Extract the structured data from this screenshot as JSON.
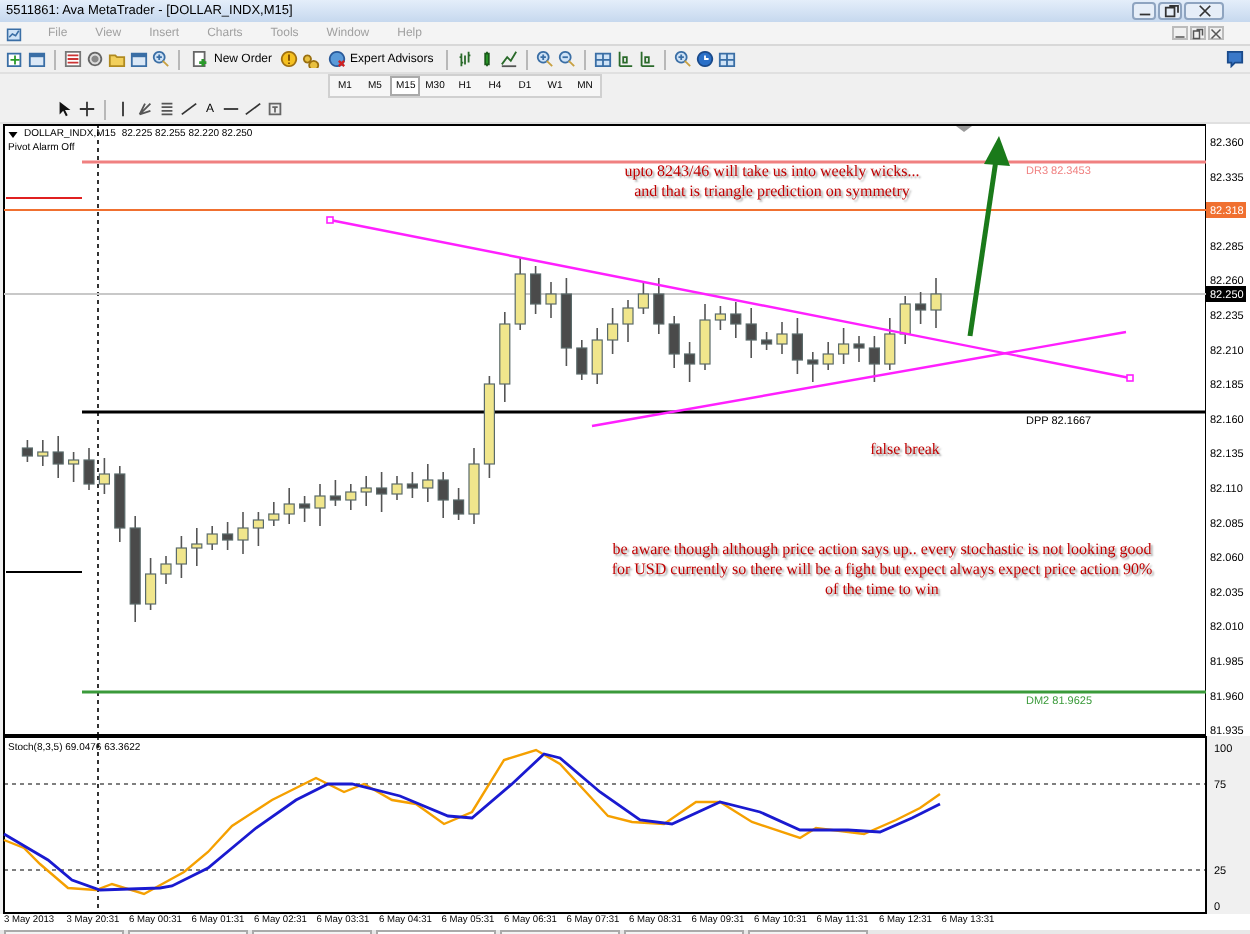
{
  "window": {
    "title": "5511861: Ava MetaTrader - [DOLLAR_INDX,M15]"
  },
  "menu": [
    "File",
    "View",
    "Insert",
    "Charts",
    "Tools",
    "Window",
    "Help"
  ],
  "toolbar": {
    "buttons": [
      "New Order",
      "Expert Advisors"
    ]
  },
  "timeframes": [
    {
      "label": "M1",
      "selected": false
    },
    {
      "label": "M5",
      "selected": false
    },
    {
      "label": "M15",
      "selected": true
    },
    {
      "label": "M30",
      "selected": false
    },
    {
      "label": "H1",
      "selected": false
    },
    {
      "label": "H4",
      "selected": false
    },
    {
      "label": "D1",
      "selected": false
    },
    {
      "label": "W1",
      "selected": false
    },
    {
      "label": "MN",
      "selected": false
    }
  ],
  "drawing_tools": {
    "text_tool": "A"
  },
  "chart": {
    "symbol": "DOLLAR_INDX,M15",
    "quote": "82.225 82.255 82.220 82.250",
    "indicator_status": "Pivot Alarm Off",
    "price_axis": [
      "82.360",
      "82.335",
      "82.285",
      "82.260",
      "82.235",
      "82.210",
      "82.185",
      "82.160",
      "82.135",
      "82.110",
      "82.085",
      "82.060",
      "82.035",
      "82.010",
      "81.985",
      "81.960",
      "81.935"
    ],
    "marked_price": "82.318",
    "current_price": "82.250",
    "levels": [
      {
        "label": "DR3 82.3453",
        "color": "#f08080"
      },
      {
        "label": "DPP 82.1667",
        "color": "#000000"
      },
      {
        "label": "DM2 81.9625",
        "color": "#3a9a3a"
      }
    ],
    "annotations": [
      "upto 8243/46 will take us into weekly wicks... and that is triangle prediction on symmetry",
      "false break",
      "be aware though although price action says up.. every stochastic is not looking good for USD currently so there will be a fight but expect always expect price action 90% of the time to win"
    ]
  },
  "stochastic": {
    "label": "Stoch(8,3,5) 69.0476 63.3622",
    "levels": [
      "100",
      "75",
      "25",
      "0"
    ]
  },
  "time_axis": [
    "3 May 2013",
    "3 May 20:31",
    "6 May 00:31",
    "6 May 01:31",
    "6 May 02:31",
    "6 May 03:31",
    "6 May 04:31",
    "6 May 05:31",
    "6 May 06:31",
    "6 May 07:31",
    "6 May 08:31",
    "6 May 09:31",
    "6 May 10:31",
    "6 May 11:31",
    "6 May 12:31",
    "6 May 13:31"
  ]
}
